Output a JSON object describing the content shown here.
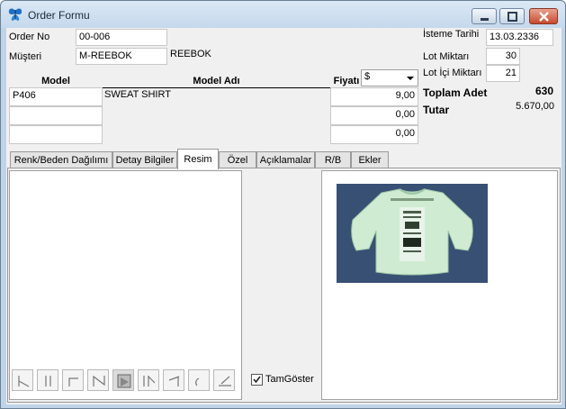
{
  "window": {
    "title": "Order Formu",
    "icon": "butterfly-icon"
  },
  "titlebar_buttons": {
    "minimize": "minimize-icon",
    "maximize": "maximize-icon",
    "close": "close-icon"
  },
  "header": {
    "order_no_label": "Order No",
    "order_no_value": "00-006",
    "musteri_label": "Müşteri",
    "musteri_value": "M-REEBOK",
    "musteri_name": "REEBOK"
  },
  "right_info": {
    "isteme_tarihi_label": "İsteme Tarihi",
    "isteme_tarihi_value": "13.03.2336",
    "lot_miktari_label": "Lot Miktarı",
    "lot_miktari_value": "30",
    "lot_ici_miktari_label": "Lot İçi Miktarı",
    "lot_ici_miktari_value": "21",
    "toplam_adet_label": "Toplam Adet",
    "toplam_adet_value": "630",
    "tutar_label": "Tutar",
    "tutar_value": "5.670,00"
  },
  "grid": {
    "col_model": "Model",
    "col_model_adi": "Model  Adı",
    "col_fiyati": "Fiyatı",
    "currency_selected": "$",
    "rows": [
      {
        "model": "P406",
        "model_adi": "SWEAT SHIRT",
        "fiyat": "9,00"
      },
      {
        "model": "",
        "model_adi": "",
        "fiyat": "0,00"
      },
      {
        "model": "",
        "model_adi": "",
        "fiyat": "0,00"
      }
    ]
  },
  "tabs": [
    {
      "label": "Renk/Beden Dağılımı"
    },
    {
      "label": "Detay Bilgiler"
    },
    {
      "label": "Resim"
    },
    {
      "label": "Özel"
    },
    {
      "label": "Açıklamalar"
    },
    {
      "label": "R/B"
    },
    {
      "label": "Ekler"
    }
  ],
  "active_tab": "Resim",
  "image_panel": {
    "tam_goster_label": "TamGöster",
    "tam_goster_checked": true
  },
  "nav_icons": [
    "first-icon",
    "prior-icon",
    "next-icon",
    "last-icon",
    "insert-icon",
    "delete-icon",
    "edit-icon",
    "refresh-icon",
    "post-icon"
  ]
}
